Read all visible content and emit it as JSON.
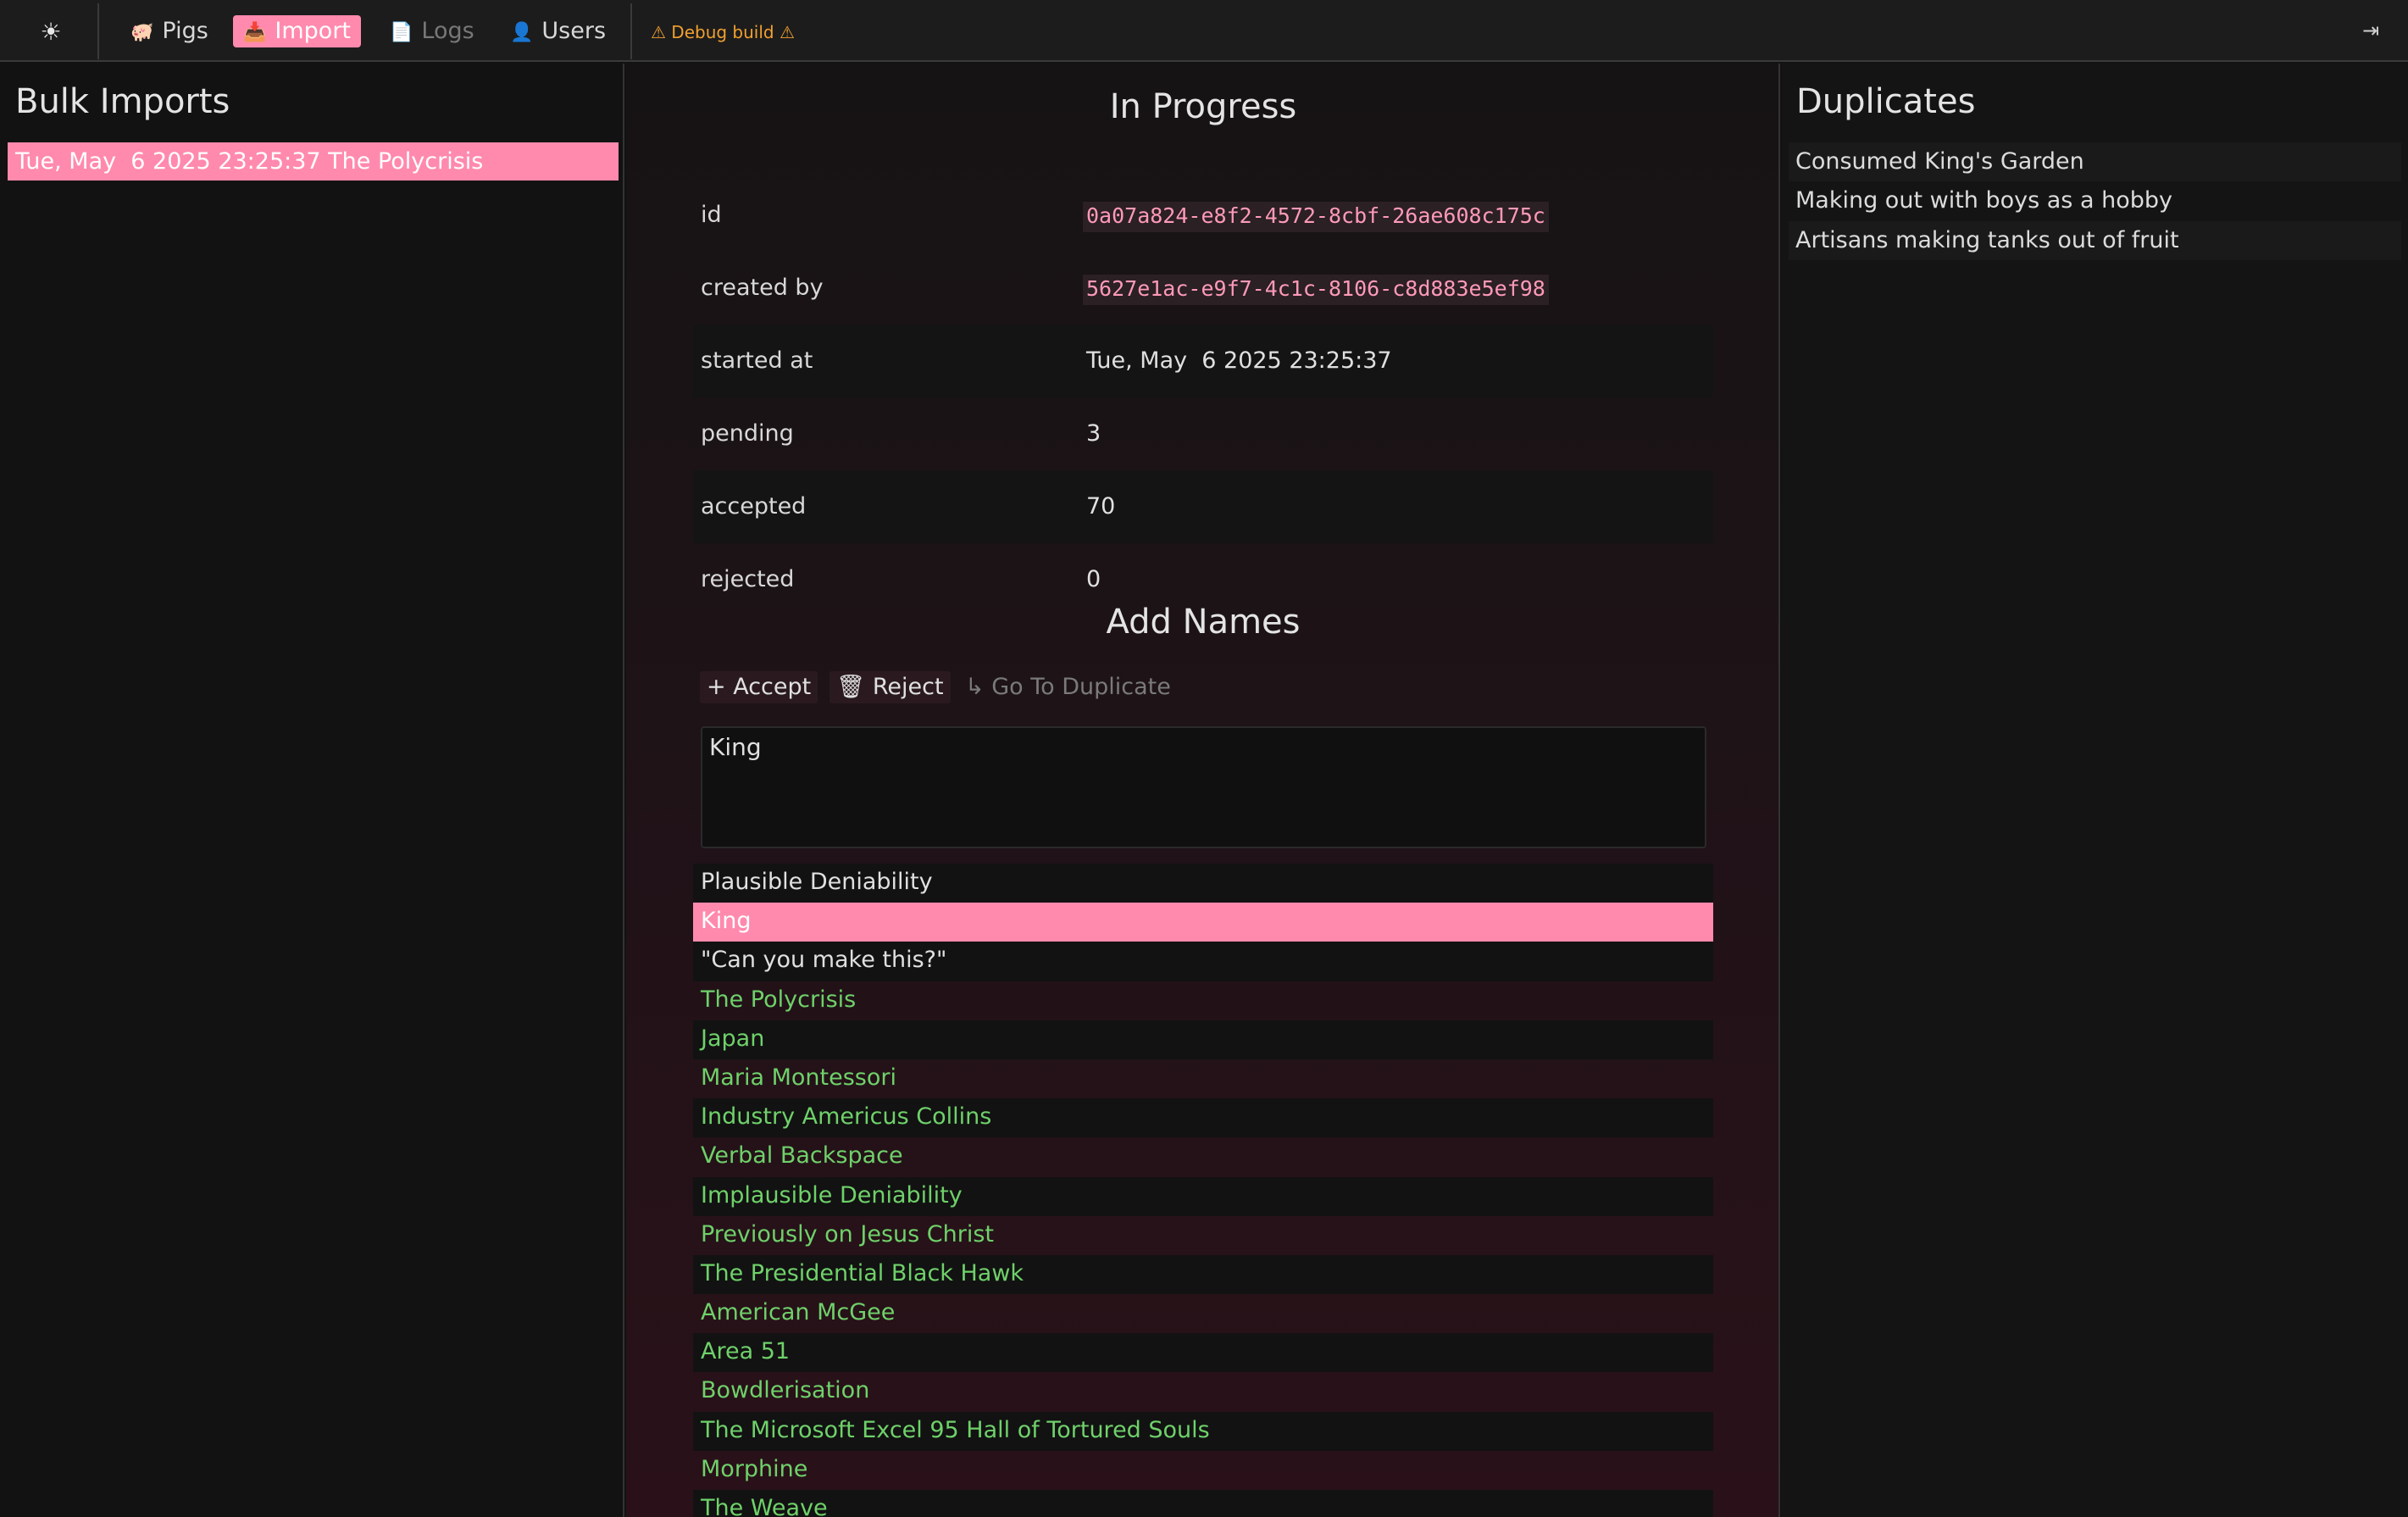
{
  "nav": {
    "theme_icon": "sun-icon",
    "items": [
      {
        "label": "Pigs",
        "icon": "pig-icon",
        "glyph": "🐖"
      },
      {
        "label": "Import",
        "icon": "import-icon",
        "glyph": "📥"
      },
      {
        "label": "Logs",
        "icon": "logs-icon",
        "glyph": "📄"
      },
      {
        "label": "Users",
        "icon": "users-icon",
        "glyph": "👤"
      }
    ],
    "debug_label": "⚠ Debug build ⚠",
    "logout_icon": "logout-icon"
  },
  "left": {
    "title": "Bulk Imports",
    "imports": [
      "Tue, May  6 2025 23:25:37 The Polycrisis"
    ]
  },
  "middle": {
    "in_progress_title": "In Progress",
    "fields": [
      {
        "key": "id",
        "value": "0a07a824-e8f2-4572-8cbf-26ae608c175c",
        "code": true
      },
      {
        "key": "created by",
        "value": "5627e1ac-e9f7-4c1c-8106-c8d883e5ef98",
        "code": true
      },
      {
        "key": "started at",
        "value": "Tue, May  6 2025 23:25:37",
        "code": false
      },
      {
        "key": "pending",
        "value": "3",
        "code": false
      },
      {
        "key": "accepted",
        "value": "70",
        "code": false
      },
      {
        "key": "rejected",
        "value": "0",
        "code": false
      }
    ],
    "add_names_title": "Add Names",
    "buttons": {
      "accept": "+ Accept",
      "reject": "🗑 Reject",
      "goto_duplicate": "↳ Go To Duplicate"
    },
    "textarea_value": "King",
    "names": [
      {
        "label": "Plausible Deniability",
        "state": "pending"
      },
      {
        "label": "King",
        "state": "selected"
      },
      {
        "label": "\"Can you make this?\"",
        "state": "pending"
      },
      {
        "label": "The Polycrisis",
        "state": "accepted"
      },
      {
        "label": "Japan",
        "state": "accepted"
      },
      {
        "label": "Maria Montessori",
        "state": "accepted"
      },
      {
        "label": "Industry Americus Collins",
        "state": "accepted"
      },
      {
        "label": "Verbal Backspace",
        "state": "accepted"
      },
      {
        "label": "Implausible Deniability",
        "state": "accepted"
      },
      {
        "label": "Previously on Jesus Christ",
        "state": "accepted"
      },
      {
        "label": "The Presidential Black Hawk",
        "state": "accepted"
      },
      {
        "label": "American McGee",
        "state": "accepted"
      },
      {
        "label": "Area 51",
        "state": "accepted"
      },
      {
        "label": "Bowdlerisation",
        "state": "accepted"
      },
      {
        "label": "The Microsoft Excel 95 Hall of Tortured Souls",
        "state": "accepted"
      },
      {
        "label": "Morphine",
        "state": "accepted"
      },
      {
        "label": "The Weave",
        "state": "accepted"
      }
    ]
  },
  "right": {
    "title": "Duplicates",
    "duplicates": [
      "Consumed King's Garden",
      "Making out with boys as a hobby",
      "Artisans making tanks out of fruit"
    ]
  },
  "colors": {
    "accent": "#ff8aad",
    "accepted_text": "#6fd16a",
    "debug": "#f0a030",
    "code_text": "#ff9ab8"
  }
}
